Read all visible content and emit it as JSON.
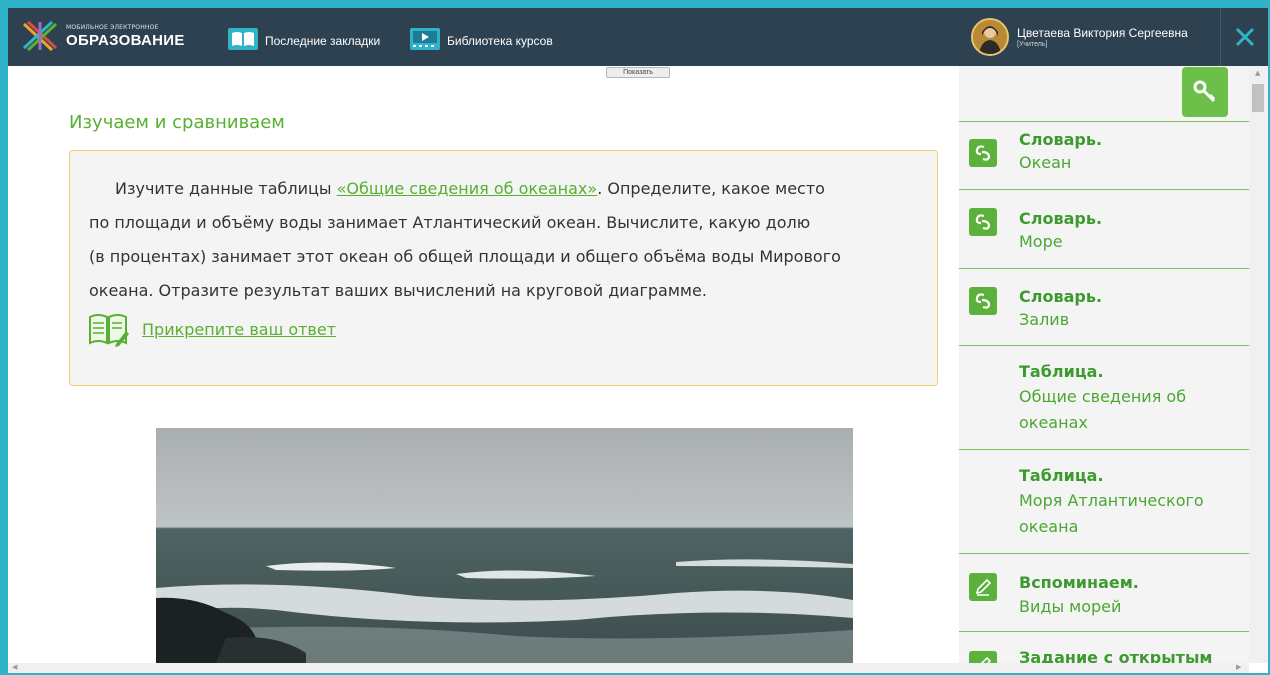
{
  "header": {
    "logo_small": "МОБИЛЬНОЕ ЭЛЕКТРОННОЕ",
    "logo_big": "ОБРАЗОВАНИЕ",
    "nav_bookmarks": "Последние закладки",
    "nav_library": "Библиотека курсов",
    "user_name": "Цветаева Виктория Сергеевна",
    "user_role": "[Учитель]"
  },
  "main": {
    "show_button": "Показать",
    "section_title": "Изучаем и сравниваем",
    "task_before_link": "Изучите данные таблицы ",
    "task_link": "«Общие сведения об океанах»",
    "task_line1_after": ". Определите, какое место",
    "task_line2": "по площади и объёму воды занимает Атлантический океан. Вычислите, какую долю",
    "task_line3": "(в процентах) занимает этот океан об общей площади и общего объёма воды Мирового",
    "task_line4": "океана. Отразите результат ваших вычислений на круговой диаграмме.",
    "attach_label": "Прикрепите ваш ответ"
  },
  "sidebar": {
    "items": [
      {
        "title": "Словарь.",
        "subtitle": "Океан",
        "icon": "link-icon"
      },
      {
        "title": "Словарь.",
        "subtitle": "Море",
        "icon": "link-icon"
      },
      {
        "title": "Словарь.",
        "subtitle": "Залив",
        "icon": "link-icon"
      },
      {
        "title": "Таблица.",
        "subtitle": "Общие сведения об океанах",
        "icon": ""
      },
      {
        "title": "Таблица.",
        "subtitle": "Моря Атлантического океана",
        "icon": ""
      },
      {
        "title": "Вспоминаем.",
        "subtitle": "Виды морей",
        "icon": "pencil-icon"
      },
      {
        "title": "Задание с открытым",
        "subtitle": "",
        "icon": "pencil-icon"
      }
    ]
  },
  "colors": {
    "topbar": "#2e4150",
    "accent_green": "#58b031",
    "frame_teal": "#2fb3c8",
    "task_border": "#f1cc72"
  }
}
